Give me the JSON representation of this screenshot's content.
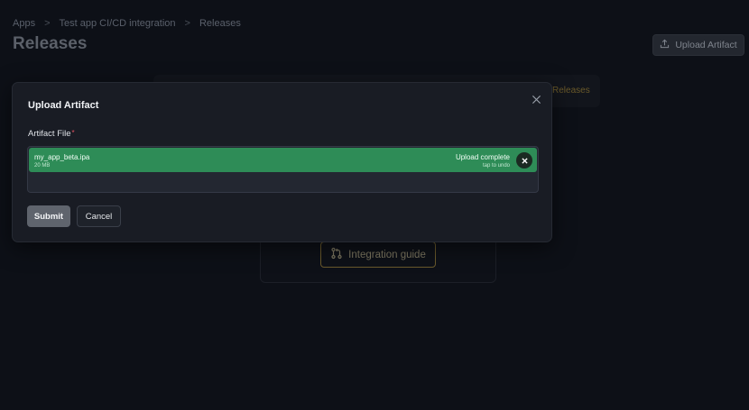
{
  "breadcrumb": {
    "items": [
      "Apps",
      "Test app CI/CD integration",
      "Releases"
    ],
    "separator": ">"
  },
  "header": {
    "title": "Releases",
    "upload_button_label": "Upload Artifact"
  },
  "background": {
    "releases_link": "Releases",
    "guide_button_label": "Integration guide"
  },
  "modal": {
    "title": "Upload Artifact",
    "field_label": "Artifact File",
    "required_marker": "*",
    "file": {
      "name": "my_app_beta.ipa",
      "size": "20 MB",
      "status": "Upload complete",
      "hint": "tap to undo"
    },
    "submit_label": "Submit",
    "cancel_label": "Cancel"
  },
  "colors": {
    "background": "#0d1017",
    "modal": "#191c24",
    "success": "#2e8c57",
    "accent_gold": "#6a5a2c",
    "required": "#e05260"
  },
  "icons": {
    "upload": "upload-icon",
    "close": "close-icon",
    "undo": "undo-x-icon",
    "guide": "git-pull-request-icon"
  }
}
